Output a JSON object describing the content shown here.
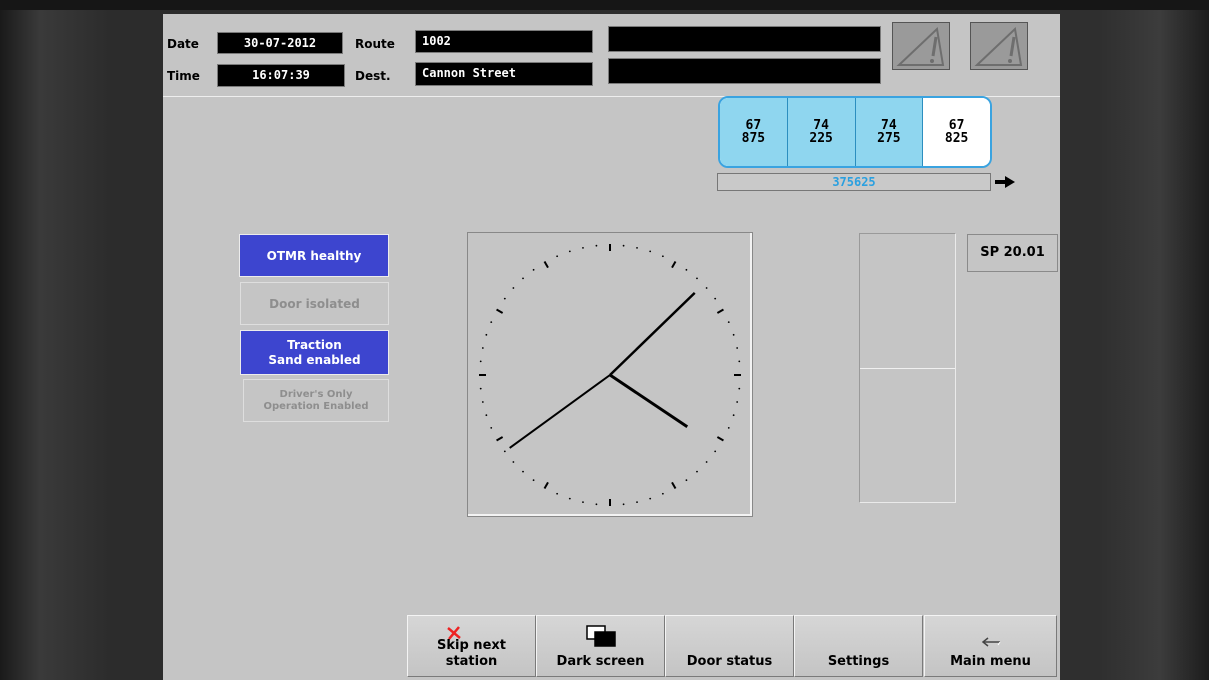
{
  "header": {
    "date_label": "Date",
    "date_value": "30-07-2012",
    "time_label": "Time",
    "time_value": "16:07:39",
    "route_label": "Route",
    "route_value": "1002",
    "dest_label": "Dest.",
    "dest_value": "Cannon Street",
    "message_line_1": "",
    "message_line_2": "",
    "warning_icons": [
      "warning-triangle-icon",
      "warning-triangle-icon"
    ]
  },
  "consist": {
    "cars": [
      {
        "line1": "67",
        "line2": "875",
        "highlight": true
      },
      {
        "line1": "74",
        "line2": "225",
        "highlight": true
      },
      {
        "line1": "74",
        "line2": "275",
        "highlight": true
      },
      {
        "line1": "67",
        "line2": "825",
        "highlight": false
      }
    ],
    "unit_number": "375625",
    "direction_icon": "arrow-right-icon",
    "car_color": "#8fd6ef",
    "border_color": "#3aa3e0"
  },
  "status": {
    "otmr": "OTMR healthy",
    "door_isolated": "Door isolated",
    "traction_line1": "Traction",
    "traction_line2": "Sand enabled",
    "doo_line1": "Driver's Only",
    "doo_line2": "Operation Enabled",
    "active_color": "#3d45cf"
  },
  "clock": {
    "hours": 16,
    "minutes": 7,
    "seconds": 39
  },
  "sp_label": "SP 20.01",
  "buttons": {
    "skip_line1": "Skip next",
    "skip_line2": "station",
    "dark_screen": "Dark screen",
    "door_status": "Door status",
    "settings": "Settings",
    "main_menu": "Main menu"
  }
}
